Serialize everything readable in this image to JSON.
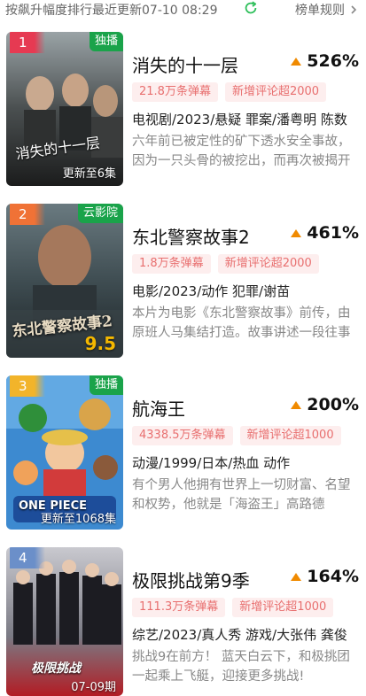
{
  "header": {
    "info": "按飙升幅度排行最近更新07-10 08:29",
    "rules_label": "榜单规则"
  },
  "colors": {
    "rank_1": "#e63a52",
    "rank_2": "#f07236",
    "rank_3": "#f2b42a",
    "rank_4": "#6b8fc9",
    "exclusive_tag": "#1aa34a",
    "badge_text": "#e86f6f",
    "badge_bg": "#fdeeee",
    "up_arrow": "#f08a00",
    "refresh": "#2fbf5b"
  },
  "items": [
    {
      "rank": "1",
      "tag": "独播",
      "poster_caption": "更新至6集",
      "poster_title": "消失的十一层",
      "title": "消失的十一层",
      "delta": "526%",
      "badges": [
        "21.8万条弹幕",
        "新增评论超2000"
      ],
      "meta": "电视剧/2023/悬疑 罪案/潘粤明 陈数",
      "desc": "六年前已被定性的矿下透水安全事故，因为一只头骨的被挖出，而再次被揭开"
    },
    {
      "rank": "2",
      "tag": "云影院",
      "poster_caption": "",
      "poster_title": "东北警察故事2",
      "poster_score": "9.5",
      "title": "东北警察故事2",
      "delta": "461%",
      "badges": [
        "1.8万条弹幕",
        "新增评论超2000"
      ],
      "meta": "电影/2023/动作 犯罪/谢苗",
      "desc": "本片为电影《东北警察故事》前传，由原班人马集结打造。故事讲述一段往事"
    },
    {
      "rank": "3",
      "tag": "独播",
      "poster_caption": "更新至1068集",
      "poster_title": "ONE PIECE",
      "title": "航海王",
      "delta": "200%",
      "badges": [
        "4338.5万条弹幕",
        "新增评论超1000"
      ],
      "meta": "动漫/1999/日本/热血 动作",
      "desc": "有个男人他拥有世界上一切财富、名望和权势，他就是「海盗王」高路德"
    },
    {
      "rank": "4",
      "tag": "",
      "poster_caption": "07-09期",
      "poster_title": "极限挑战",
      "title": "极限挑战第9季",
      "delta": "164%",
      "badges": [
        "111.3万条弹幕",
        "新增评论超1000"
      ],
      "meta": "综艺/2023/真人秀 游戏/大张伟 龚俊",
      "desc": "挑战9在前方！ 蓝天白云下，和极挑团一起乘上飞艇，迎接更多挑战!"
    }
  ]
}
